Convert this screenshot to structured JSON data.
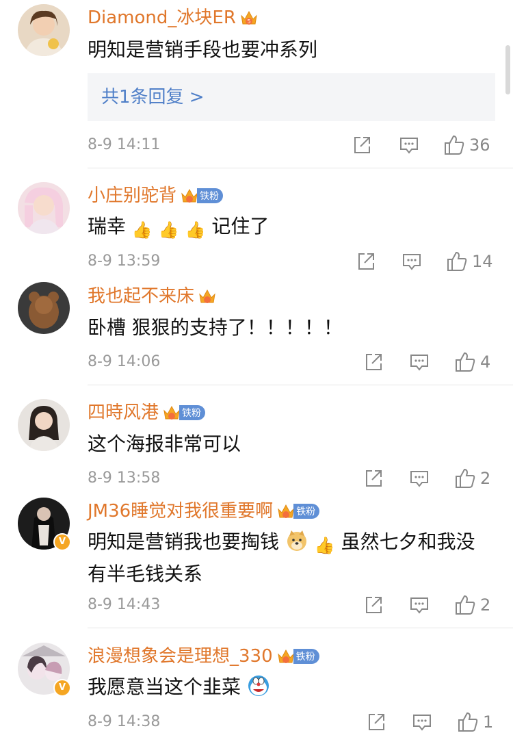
{
  "comments": [
    {
      "username": "Diamond_冰块ER",
      "badge_level": "5",
      "fan_badge": "",
      "text": "明知是营销手段也要冲系列",
      "replies": "共1条回复 >",
      "time": "8-9 14:11",
      "likes": "36"
    },
    {
      "username": "小庄别驼背",
      "fan_badge": "铁粉",
      "text_parts": [
        "瑞幸",
        "记住了"
      ],
      "time": "8-9 13:59",
      "likes": "14"
    },
    {
      "username": "我也起不来床",
      "fan_badge": "",
      "text": "卧槽 狠狠的支持了！！！！！",
      "time": "8-9 14:06",
      "likes": "4"
    },
    {
      "username": "四時风港",
      "fan_badge": "铁粉",
      "text": "这个海报非常可以",
      "time": "8-9 13:58",
      "likes": "2"
    },
    {
      "username": "JM36睡觉对我很重要啊",
      "fan_badge": "铁粉",
      "verified": "V",
      "text_parts": [
        "明知是营销我也要掏钱",
        "虽然七夕和我没有半毛钱关系"
      ],
      "time": "8-9 14:43",
      "likes": "2"
    },
    {
      "username": "浪漫想象会是理想_330",
      "fan_badge": "铁粉",
      "verified": "V",
      "text": "我愿意当这个韭菜",
      "time": "8-9 14:38",
      "likes": "1"
    }
  ],
  "emoji": {
    "thumbs_up": "👍"
  },
  "colors": {
    "username": "#e0772b",
    "link": "#4f7fc8",
    "fan_badge": "#5f8fd6",
    "meta": "#999999"
  }
}
